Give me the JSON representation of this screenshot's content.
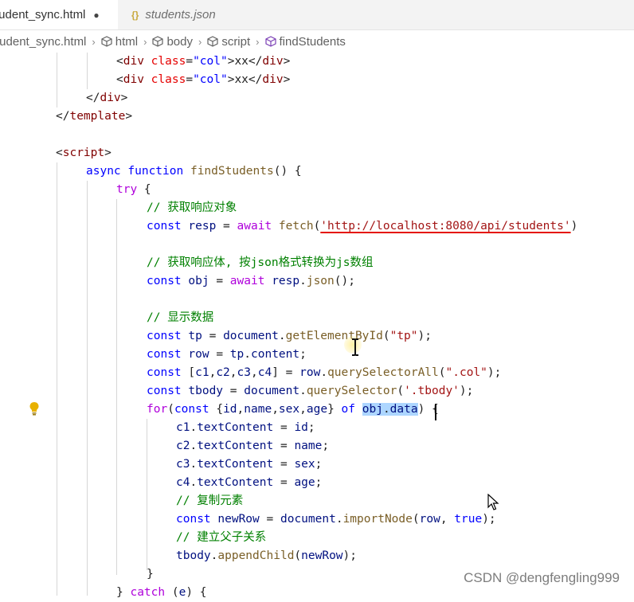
{
  "tabs": [
    {
      "label": "tudent_sync.html",
      "modified_marker": "●"
    },
    {
      "label": "students.json",
      "icon_text": "{}"
    }
  ],
  "breadcrumb": [
    "tudent_sync.html",
    "html",
    "body",
    "script",
    "findStudents"
  ],
  "code": {
    "l1": [
      "<",
      "div",
      " ",
      "class",
      "=",
      "\"col\"",
      ">xx</",
      "div",
      ">"
    ],
    "l2": [
      "<",
      "div",
      " ",
      "class",
      "=",
      "\"col\"",
      ">xx</",
      "div",
      ">"
    ],
    "l3": [
      "</",
      "div",
      ">"
    ],
    "l4": [
      "</",
      "template",
      ">"
    ],
    "l6": [
      "<",
      "script",
      ">"
    ],
    "l7": [
      "async",
      "function",
      "findStudents",
      "() {"
    ],
    "l8": [
      "try",
      " {"
    ],
    "l9": "// 获取响应对象",
    "l10": [
      "const",
      "resp",
      "=",
      "await",
      "fetch",
      "(",
      "'http://localhost:8080/api/students'",
      ")"
    ],
    "l12": "// 获取响应体, 按json格式转换为js数组",
    "l13": [
      "const",
      "obj",
      "=",
      "await",
      "resp",
      ".",
      "json",
      "();"
    ],
    "l15": "// 显示数据",
    "l16": [
      "const",
      "tp",
      "=",
      "document",
      ".",
      "getElementById",
      "(",
      "\"tp\"",
      ");"
    ],
    "l17": [
      "const",
      "row",
      "=",
      "tp",
      ".",
      "content",
      ";"
    ],
    "l18": [
      "const",
      "[",
      "c1",
      ",",
      "c2",
      ",",
      "c3",
      ",",
      "c4",
      "]",
      "=",
      "row",
      ".",
      "querySelectorAll",
      "(",
      "\".col\"",
      ");"
    ],
    "l19": [
      "const",
      "tbody",
      "=",
      "document",
      ".",
      "querySelector",
      "(",
      "'.tbody'",
      ");"
    ],
    "l20": [
      "for",
      "(",
      "const",
      "{",
      "id",
      ",",
      "name",
      ",",
      "sex",
      ",",
      "age",
      "}",
      "of",
      "obj",
      ".",
      "data",
      ") {"
    ],
    "l21": [
      "c1",
      ".",
      "textContent",
      "=",
      "id",
      ";"
    ],
    "l22": [
      "c2",
      ".",
      "textContent",
      "=",
      "name",
      ";"
    ],
    "l23": [
      "c3",
      ".",
      "textContent",
      "=",
      "sex",
      ";"
    ],
    "l24": [
      "c4",
      ".",
      "textContent",
      "=",
      "age",
      ";"
    ],
    "l25": "// 复制元素",
    "l26": [
      "const",
      "newRow",
      "=",
      "document",
      ".",
      "importNode",
      "(",
      "row",
      ", ",
      "true",
      ");"
    ],
    "l27": "// 建立父子关系",
    "l28": [
      "tbody",
      ".",
      "appendChild",
      "(",
      "newRow",
      ");"
    ],
    "l29": "}",
    "l30": [
      "}",
      "catch",
      "(",
      "e",
      ") {"
    ]
  },
  "watermark": "CSDN @dengfengling999",
  "colors": {
    "tag": "#800000",
    "attr": "#e50000",
    "string": "#a31515",
    "keyword": "#0000ff",
    "flow": "#af00db",
    "variable": "#001080",
    "function": "#795e26",
    "comment": "#008000",
    "selection": "#add6ff"
  }
}
